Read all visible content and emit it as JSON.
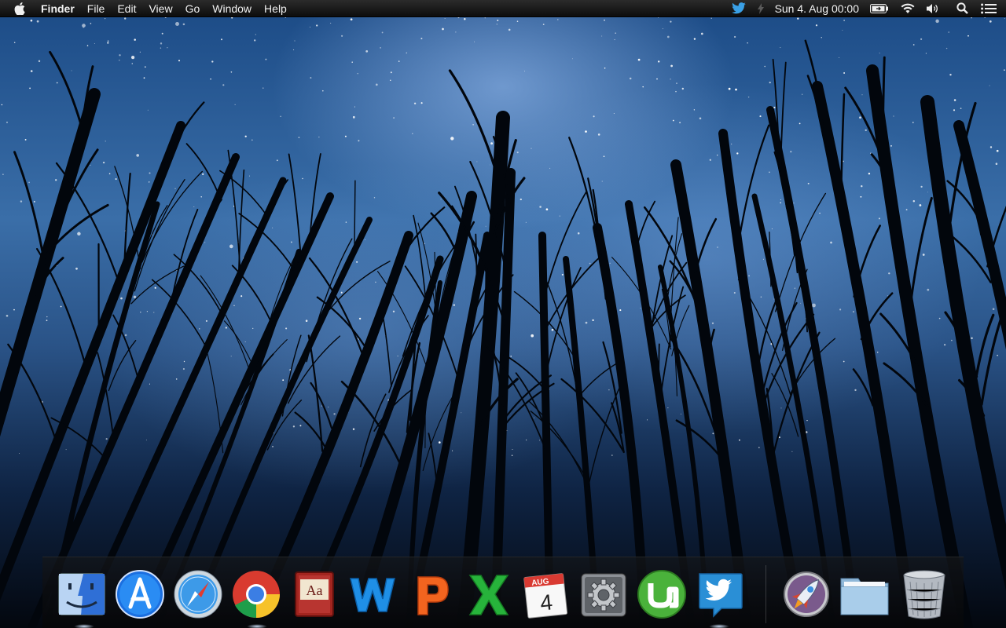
{
  "menubar": {
    "app_name": "Finder",
    "menus": [
      "File",
      "Edit",
      "View",
      "Go",
      "Window",
      "Help"
    ],
    "clock": "Sun 4. Aug  00:00",
    "status_icons": [
      "twitter-icon",
      "bolt-icon",
      "battery-icon",
      "wifi-icon",
      "volume-icon",
      "spotlight-icon",
      "notification-center-icon"
    ]
  },
  "dock": {
    "apps": [
      {
        "name": "Finder",
        "icon": "finder-icon",
        "running": true
      },
      {
        "name": "App Store",
        "icon": "app-store-icon",
        "running": false
      },
      {
        "name": "Safari",
        "icon": "safari-icon",
        "running": false
      },
      {
        "name": "Google Chrome",
        "icon": "chrome-icon",
        "running": true
      },
      {
        "name": "Dictionary",
        "icon": "dictionary-icon",
        "running": false,
        "label": "Aa"
      },
      {
        "name": "Word",
        "icon": "word-icon",
        "running": false
      },
      {
        "name": "PowerPoint",
        "icon": "powerpoint-icon",
        "running": false
      },
      {
        "name": "Excel",
        "icon": "excel-icon",
        "running": false
      },
      {
        "name": "Calendar",
        "icon": "calendar-icon",
        "running": false,
        "month": "AUG",
        "day": "4"
      },
      {
        "name": "System Preferences",
        "icon": "gear-icon",
        "running": false
      },
      {
        "name": "uTorrent",
        "icon": "utorrent-icon",
        "running": false
      },
      {
        "name": "Twitter",
        "icon": "twitter-icon",
        "running": true
      },
      {
        "name": "Launchpad",
        "icon": "rocket-icon",
        "running": false
      },
      {
        "name": "Documents",
        "icon": "folder-icon",
        "running": false
      },
      {
        "name": "Trash",
        "icon": "trash-icon",
        "running": false
      }
    ]
  }
}
